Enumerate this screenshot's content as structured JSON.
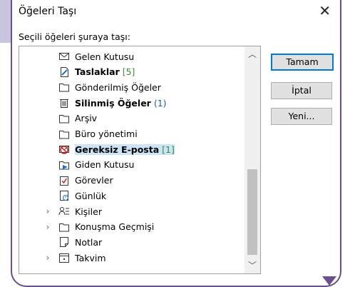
{
  "dialog": {
    "title": "Öğeleri Taşı",
    "close_glyph": "✕",
    "prompt": "Seçili öğeleri şuraya taşı:"
  },
  "tree": {
    "items": [
      {
        "label": "Gelen Kutusu",
        "icon": "mail-icon",
        "bold": false,
        "count": "",
        "count_color": ""
      },
      {
        "label": "Taslaklar",
        "icon": "draft-icon",
        "bold": true,
        "count": "[5]",
        "count_color": "#3a8a3a"
      },
      {
        "label": "Gönderilmiş Öğeler",
        "icon": "folder-icon",
        "bold": false,
        "count": "",
        "count_color": ""
      },
      {
        "label": "Silinmiş Öğeler",
        "icon": "trash-icon",
        "bold": true,
        "count": "(1)",
        "count_color": "#1f5ea8"
      },
      {
        "label": "Arşiv",
        "icon": "folder-icon",
        "bold": false,
        "count": "",
        "count_color": ""
      },
      {
        "label": "Büro yönetimi",
        "icon": "folder-icon",
        "bold": false,
        "count": "",
        "count_color": ""
      },
      {
        "label": "Gereksiz E-posta",
        "icon": "junk-mail-icon",
        "bold": true,
        "count": "[1]",
        "count_color": "#3a8a3a",
        "selected": true
      },
      {
        "label": "Giden Kutusu",
        "icon": "outbox-icon",
        "bold": false,
        "count": "",
        "count_color": ""
      },
      {
        "label": "Görevler",
        "icon": "tasks-icon",
        "bold": false,
        "count": "",
        "count_color": ""
      },
      {
        "label": "Günlük",
        "icon": "journal-icon",
        "bold": false,
        "count": "",
        "count_color": ""
      },
      {
        "label": "Kişiler",
        "icon": "contacts-icon",
        "bold": false,
        "count": "",
        "count_color": "",
        "expandable": true
      },
      {
        "label": "Konuşma Geçmişi",
        "icon": "folder-icon",
        "bold": false,
        "count": "",
        "count_color": "",
        "expandable": true
      },
      {
        "label": "Notlar",
        "icon": "notes-icon",
        "bold": false,
        "count": "",
        "count_color": ""
      },
      {
        "label": "Takvim",
        "icon": "calendar-icon",
        "bold": false,
        "count": "",
        "count_color": "",
        "expandable": true
      }
    ]
  },
  "buttons": {
    "ok": "Tamam",
    "cancel": "İptal",
    "new": "Yeni..."
  },
  "colors": {
    "accent": "#0078d7",
    "frame": "#6b4f8f",
    "selection": "#cce4f7"
  }
}
